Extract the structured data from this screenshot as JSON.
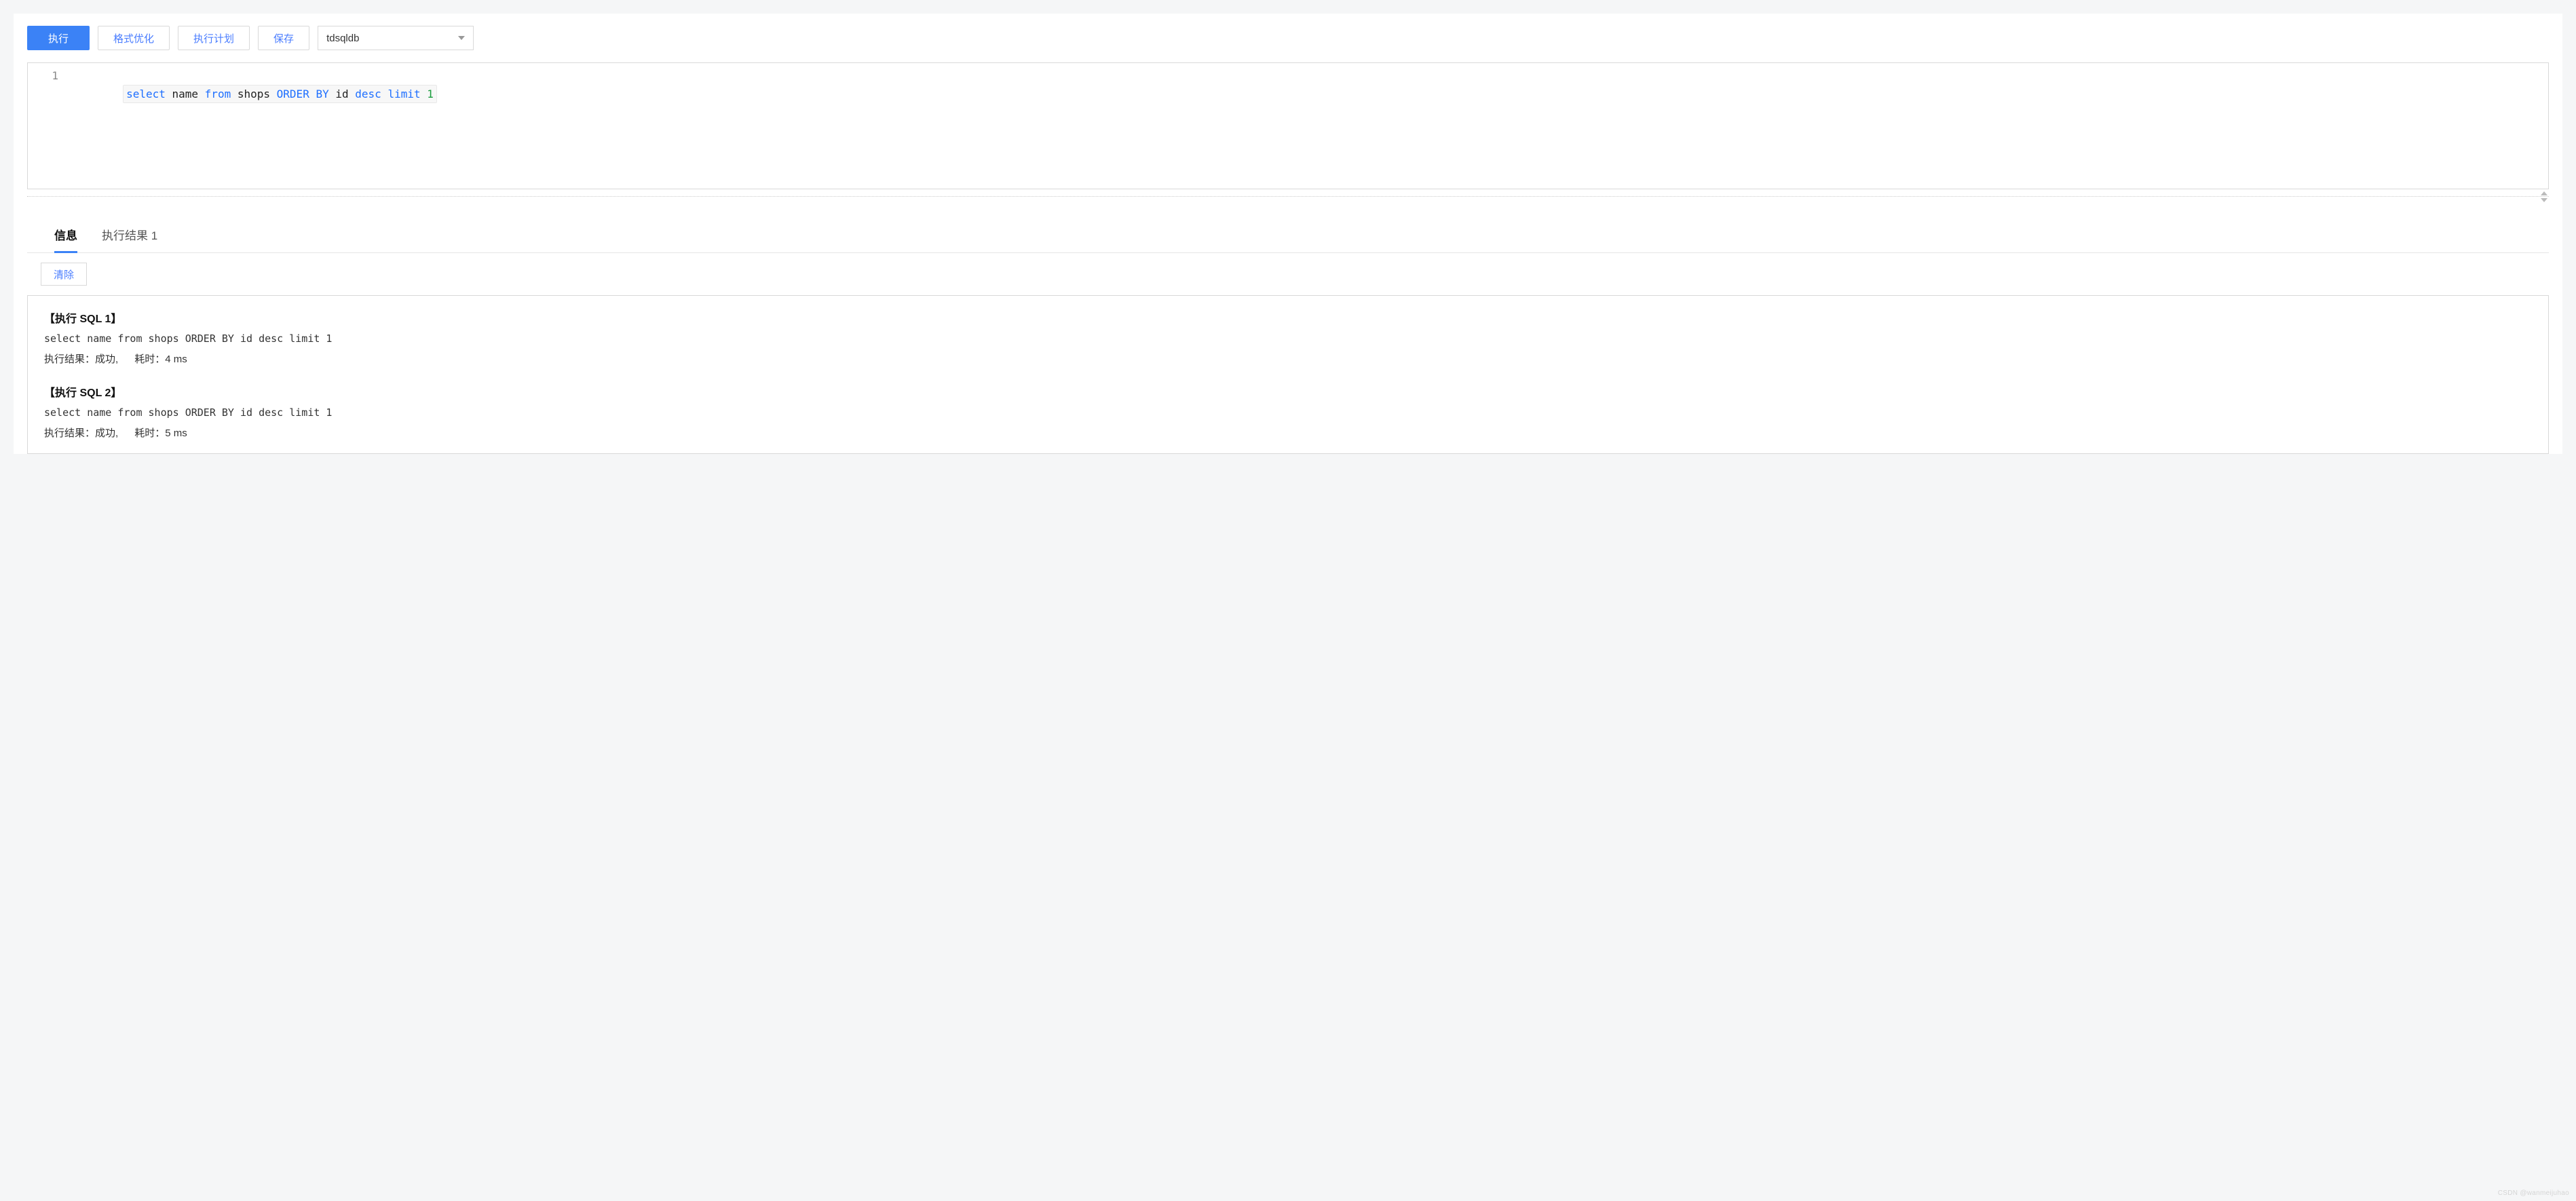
{
  "toolbar": {
    "execute_label": "执行",
    "format_label": "格式优化",
    "explain_label": "执行计划",
    "save_label": "保存",
    "db_selected": "tdsqldb"
  },
  "editor": {
    "line_number": "1",
    "sql_tokens": [
      {
        "text": "select",
        "class": "tok-kw"
      },
      {
        "text": " ",
        "class": ""
      },
      {
        "text": "name",
        "class": "tok-id"
      },
      {
        "text": " ",
        "class": ""
      },
      {
        "text": "from",
        "class": "tok-kw"
      },
      {
        "text": " ",
        "class": ""
      },
      {
        "text": "shops",
        "class": "tok-id"
      },
      {
        "text": " ",
        "class": ""
      },
      {
        "text": "ORDER",
        "class": "tok-kw"
      },
      {
        "text": " ",
        "class": ""
      },
      {
        "text": "BY",
        "class": "tok-kw"
      },
      {
        "text": " ",
        "class": ""
      },
      {
        "text": "id",
        "class": "tok-id"
      },
      {
        "text": " ",
        "class": ""
      },
      {
        "text": "desc",
        "class": "tok-kw"
      },
      {
        "text": " ",
        "class": ""
      },
      {
        "text": "limit",
        "class": "tok-kw"
      },
      {
        "text": " ",
        "class": ""
      },
      {
        "text": "1",
        "class": "tok-num"
      }
    ]
  },
  "tabs": {
    "info_label": "信息",
    "result_label": "执行结果 1",
    "active": 0
  },
  "clear_label": "清除",
  "results": [
    {
      "head": "【执行 SQL 1】",
      "sql": "select name from shops ORDER BY id desc limit 1",
      "status_label": "执行结果：",
      "status_value": "成功,",
      "time_label": "耗时：",
      "time_value": "4 ms"
    },
    {
      "head": "【执行 SQL 2】",
      "sql": "select name from shops ORDER BY id desc limit 1",
      "status_label": "执行结果：",
      "status_value": "成功,",
      "time_label": "耗时：",
      "time_value": "5 ms"
    }
  ],
  "watermark": "CSDN @wanmeijuhao"
}
